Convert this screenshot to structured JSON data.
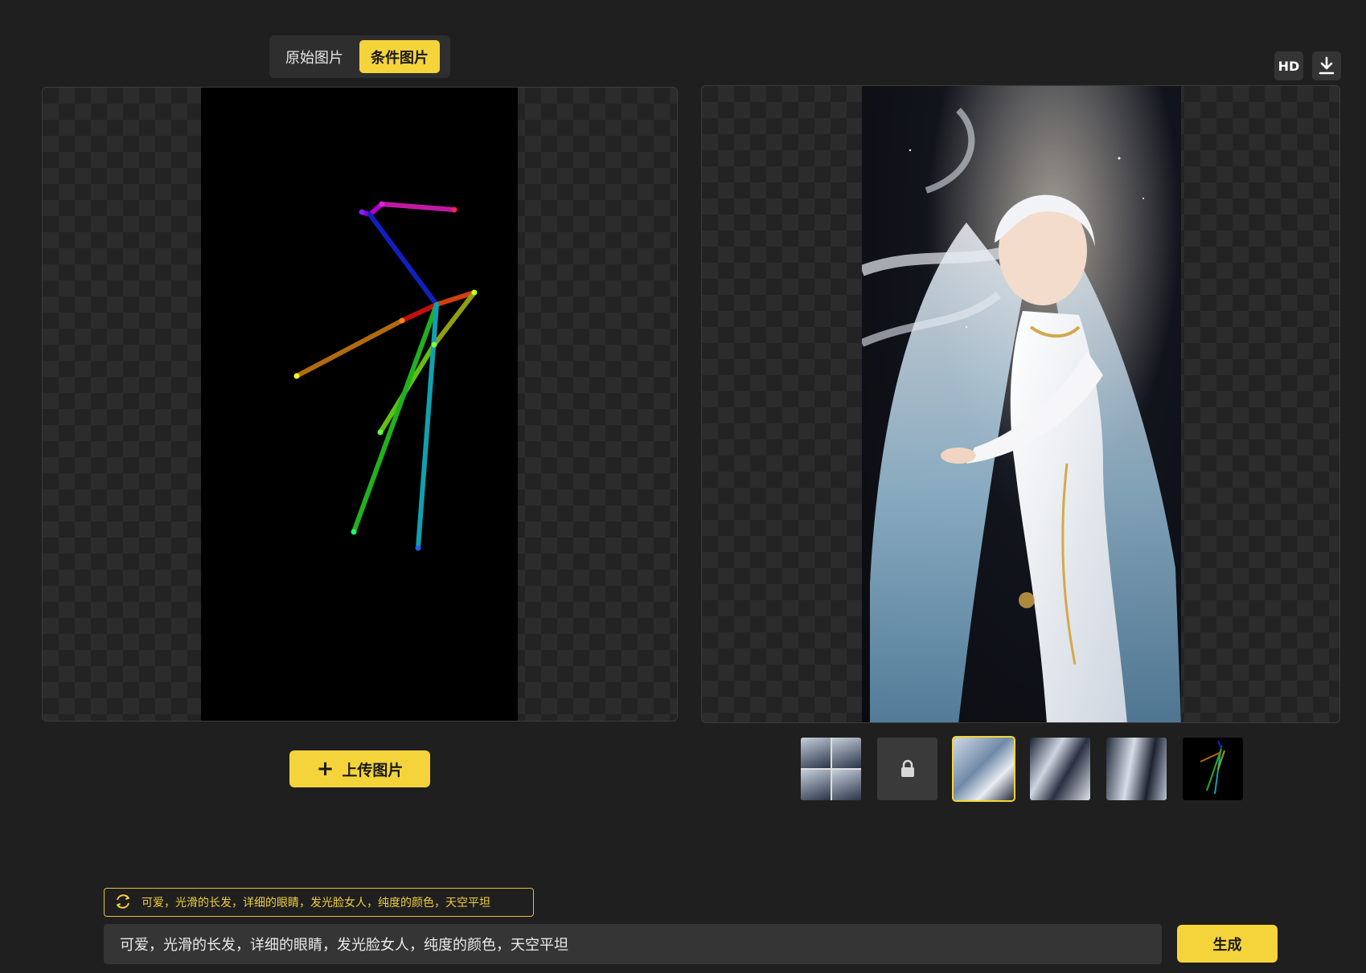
{
  "tabs": [
    {
      "label": "原始图片",
      "active": false
    },
    {
      "label": "条件图片",
      "active": true
    }
  ],
  "toolbar": {
    "hd_label": "HD",
    "download_icon": "download-icon"
  },
  "left": {
    "upload_label": "上传图片",
    "upload_icon": "plus-icon"
  },
  "thumbnails": [
    {
      "kind": "grid",
      "active": false
    },
    {
      "kind": "locked",
      "active": false,
      "icon": "lock-icon"
    },
    {
      "kind": "art",
      "active": true
    },
    {
      "kind": "art",
      "active": false
    },
    {
      "kind": "art",
      "active": false
    },
    {
      "kind": "pose",
      "active": false
    }
  ],
  "prompt": {
    "suggestion": "可爱，光滑的长发，详细的眼睛，发光脸女人，纯度的颜色，天空平坦",
    "suggestion_icon": "refresh-icon",
    "value": "可爱，光滑的长发，详细的眼睛，发光脸女人，纯度的颜色，天空平坦",
    "generate_label": "生成"
  },
  "colors": {
    "accent": "#f5d43b",
    "background": "#1f1f1f",
    "panel": "#2e2e2e"
  }
}
